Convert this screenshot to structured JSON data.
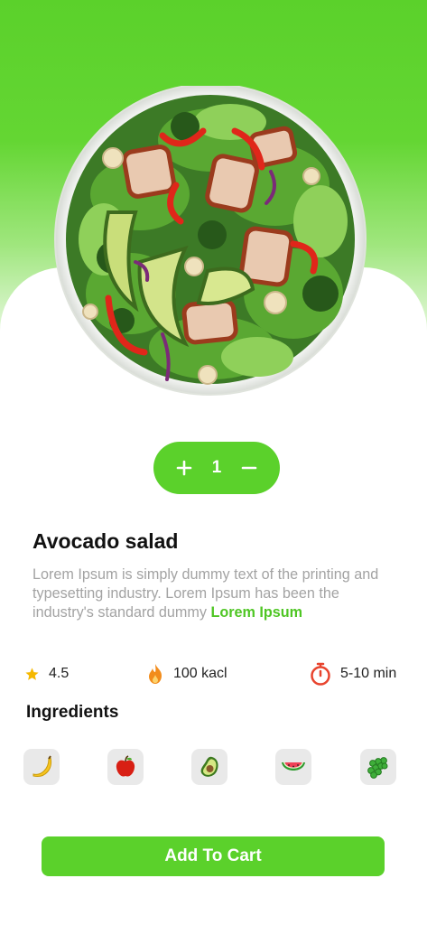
{
  "product": {
    "name": "Avocado salad",
    "description": "Lorem Ipsum is simply dummy text of the printing and typesetting industry. Lorem Ipsum has been the industry's standard dummy",
    "read_more": "Lorem Ipsum",
    "image_icon": "salad-bowl-image"
  },
  "quantity": {
    "value": "1",
    "increase_icon": "plus-icon",
    "decrease_icon": "minus-icon"
  },
  "stats": {
    "rating": "4.5",
    "calories": "100 kacl",
    "time": "5-10 min",
    "rating_icon": "star-icon",
    "calories_icon": "flame-icon",
    "time_icon": "stopwatch-icon"
  },
  "ingredients": {
    "title": "Ingredients",
    "items": [
      "banana-icon",
      "apple-icon",
      "avocado-icon",
      "watermelon-icon",
      "grapes-icon"
    ]
  },
  "cart": {
    "label": "Add To Cart"
  },
  "colors": {
    "accent": "#5bd12b",
    "accent_text": "#4fc624",
    "muted_text": "#a3a3a3",
    "star": "#f5b800",
    "flame": "#f28c1b",
    "timer": "#e8442e",
    "chip": "#e9e9e9"
  }
}
